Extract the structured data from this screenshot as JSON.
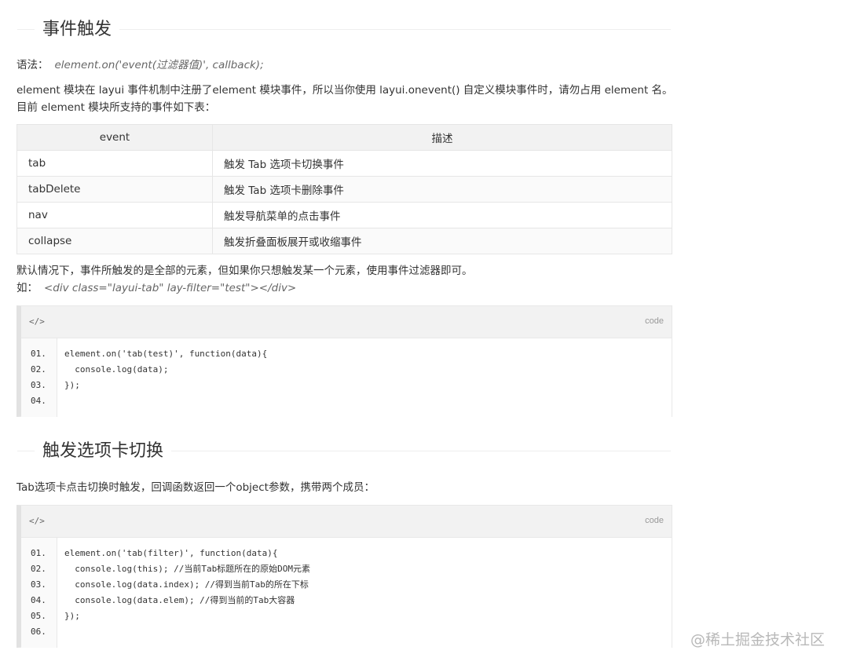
{
  "section1": {
    "title": "事件触发",
    "syntax_label": "语法：",
    "syntax_code": "element.on('event(过滤器值)', callback);",
    "intro": "element 模块在 layui 事件机制中注册了element 模块事件，所以当你使用 layui.onevent() 自定义模块事件时，请勿占用 element 名。目前 element 模块所支持的事件如下表：",
    "table": {
      "headers": [
        "event",
        "描述"
      ],
      "rows": [
        [
          "tab",
          "触发 Tab 选项卡切换事件"
        ],
        [
          "tabDelete",
          "触发 Tab 选项卡删除事件"
        ],
        [
          "nav",
          "触发导航菜单的点击事件"
        ],
        [
          "collapse",
          "触发折叠面板展开或收缩事件"
        ]
      ]
    },
    "note": "默认情况下，事件所触发的是全部的元素，但如果你只想触发某一个元素，使用事件过滤器即可。",
    "example_label": "如：",
    "example_code": "<div class=\"layui-tab\" lay-filter=\"test\"></div>",
    "code": {
      "tag": "</>",
      "lang": "code",
      "lines": [
        {
          "num": "01.",
          "text": "element.on('tab(test)', function(data){"
        },
        {
          "num": "02.",
          "text": "  console.log(data);"
        },
        {
          "num": "03.",
          "text": "});"
        },
        {
          "num": "04.",
          "text": ""
        }
      ]
    }
  },
  "section2": {
    "title": "触发选项卡切换",
    "intro": "Tab选项卡点击切换时触发，回调函数返回一个object参数，携带两个成员：",
    "code": {
      "tag": "</>",
      "lang": "code",
      "lines": [
        {
          "num": "01.",
          "text": "element.on('tab(filter)', function(data){"
        },
        {
          "num": "02.",
          "text": "  console.log(this); //当前Tab标题所在的原始DOM元素"
        },
        {
          "num": "03.",
          "text": "  console.log(data.index); //得到当前Tab的所在下标"
        },
        {
          "num": "04.",
          "text": "  console.log(data.elem); //得到当前的Tab大容器"
        },
        {
          "num": "05.",
          "text": "});"
        },
        {
          "num": "06.",
          "text": ""
        }
      ]
    }
  },
  "watermark": "@稀土掘金技术社区"
}
